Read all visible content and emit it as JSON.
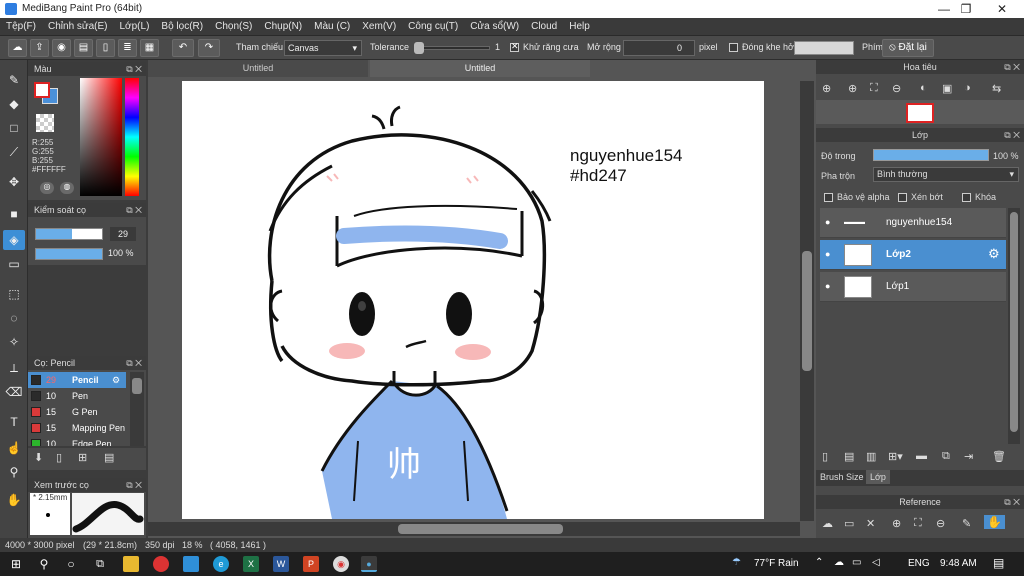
{
  "window": {
    "title": "MediBang Paint Pro (64bit)",
    "minimize": "—",
    "maximize": "❐",
    "close": "✕"
  },
  "menu": [
    "Tệp(F)",
    "Chỉnh sửa(E)",
    "Lớp(L)",
    "Bộ lọc(R)",
    "Chọn(S)",
    "Chụp(N)",
    "Màu (C)",
    "Xem(V)",
    "Công cụ(T)",
    "Cửa sổ(W)",
    "Cloud",
    "Help"
  ],
  "toolbar": {
    "reference_label": "Tham chiếu",
    "reference_value": "Canvas",
    "tolerance_label": "Tolerance",
    "tolerance_value": "1",
    "antialias_label": "Khử răng cưa",
    "antialias_checked": true,
    "expand_label": "Mở rộng",
    "expand_value": "0",
    "expand_unit": "pixel",
    "gap_label": "Đóng khe hở",
    "key_label": "Phím",
    "reset_label": "Đặt lại"
  },
  "color_panel": {
    "title": "Màu",
    "r": "R:255",
    "g": "G:255",
    "b": "B:255",
    "hex": "#FFFFFF",
    "primary": "#ffffff",
    "secondary": "#4a90d9"
  },
  "brush_control": {
    "title": "Kiểm soát cọ",
    "size": "29",
    "opacity": "100 %",
    "opacity_fraction": 1.0
  },
  "brush_list": {
    "title": "Cọ: Pencil",
    "items": [
      {
        "size": "29",
        "name": "Pencil",
        "color": "#2a2a2a",
        "selected": true
      },
      {
        "size": "10",
        "name": "Pen",
        "color": "#2a2a2a"
      },
      {
        "size": "15",
        "name": "G Pen",
        "color": "#d83a3a"
      },
      {
        "size": "15",
        "name": "Mapping Pen",
        "color": "#d83a3a"
      },
      {
        "size": "10",
        "name": "Edge Pen",
        "color": "#2cb52c"
      }
    ]
  },
  "preview": {
    "title": "Xem trước cọ",
    "size": "2.15mm"
  },
  "canvas": {
    "tabs": [
      "Untitled",
      "Untitled"
    ],
    "text1": "nguyenhue154",
    "text2": "#hd247",
    "shirt_text": "帅"
  },
  "navigator": {
    "title": "Hoa tiêu"
  },
  "layers": {
    "title": "Lớp",
    "opacity_label": "Độ trong",
    "opacity_value": "100 %",
    "opacity_fraction": 1.0,
    "blend_label": "Pha trộn",
    "blend_value": "Bình thường",
    "protect_alpha": "Bảo vệ alpha",
    "clip": "Xén bớt",
    "lock": "Khóa",
    "items": [
      {
        "name": "nguyenhue154",
        "selected": false
      },
      {
        "name": "Lớp2",
        "selected": true
      },
      {
        "name": "Lớp1",
        "selected": false
      }
    ],
    "tabs": [
      "Brush Size",
      "Lớp"
    ]
  },
  "reference": {
    "title": "Reference"
  },
  "status": {
    "size": "4000 * 3000 pixel",
    "cm": "(29 * 21.8cm)",
    "dpi": "350 dpi",
    "zoom": "18 %",
    "coords": "( 4058, 1461 )"
  },
  "taskbar": {
    "weather": "77°F  Rain",
    "lang": "ENG",
    "time": "9:48 AM"
  },
  "colors": {
    "accent": "#4a8fd0",
    "shirt": "#8fb5ee",
    "blush": "#f7b8b8"
  }
}
